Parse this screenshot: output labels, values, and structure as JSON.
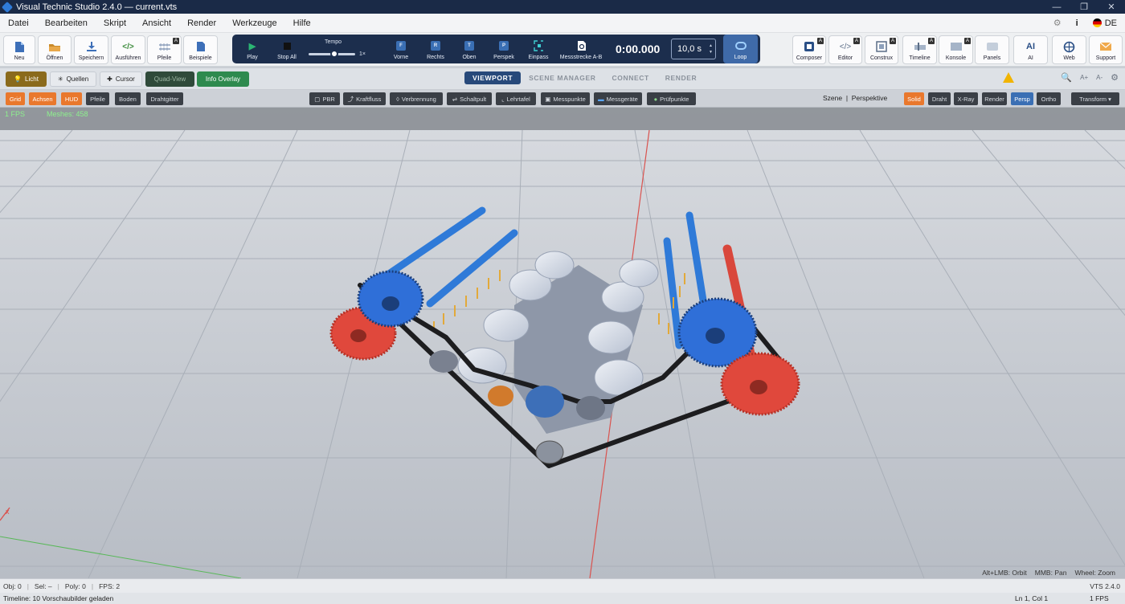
{
  "window": {
    "title": "Visual Technic Studio 2.4.0 — current.vts"
  },
  "menu": {
    "items": [
      "Datei",
      "Bearbeiten",
      "Skript",
      "Ansicht",
      "Render",
      "Werkzeuge",
      "Hilfe"
    ],
    "lang": "DE",
    "info": "i"
  },
  "toolbar": {
    "left": [
      {
        "label": "Neu",
        "icon": "new-file-icon"
      },
      {
        "label": "Öffnen",
        "icon": "folder-icon"
      },
      {
        "label": "Speichern",
        "icon": "save-icon"
      },
      {
        "label": "Ausführen",
        "icon": "run-code-icon"
      },
      {
        "label": "Pfeile",
        "icon": "arrows-icon"
      },
      {
        "label": "Beispiele",
        "icon": "examples-icon"
      }
    ],
    "play": {
      "play": "Play",
      "stop": "Stop All",
      "tempo": "Tempo",
      "tempo_value": "1×",
      "tempo_level": 0.55,
      "views": [
        "Vorne",
        "Rechts",
        "Oben",
        "Perspek",
        "Einpass",
        "Messstrecke A-B"
      ],
      "view_letters": [
        "F",
        "R",
        "T",
        "P"
      ],
      "time": "0:00.000",
      "duration": "10,0 s",
      "loop": "Loop"
    },
    "right": [
      {
        "label": "Composer",
        "icon": "composer-icon"
      },
      {
        "label": "Editor",
        "icon": "code-editor-icon"
      },
      {
        "label": "Construx",
        "icon": "construx-icon"
      },
      {
        "label": "Timeline",
        "icon": "timeline-icon"
      },
      {
        "label": "Konsole",
        "icon": "console-icon"
      },
      {
        "label": "Panels",
        "icon": "panels-icon"
      },
      {
        "label": "AI",
        "icon": "ai-icon"
      },
      {
        "label": "Web",
        "icon": "globe-icon"
      },
      {
        "label": "Support",
        "icon": "mail-icon"
      }
    ]
  },
  "toolbar2": {
    "licht": "Licht",
    "quellen": "Quellen",
    "cursor": "Cursor",
    "quadview": "Quad-View",
    "infooverlay": "Info Overlay",
    "tabs": [
      "VIEWPORT",
      "SCENE MANAGER",
      "CONNECT",
      "RENDER"
    ],
    "font_plus": "A+",
    "font_minus": "A-"
  },
  "toolbar3": {
    "left": [
      "Grid",
      "Achsen",
      "HUD",
      "Pfeile",
      "Boden",
      "Drahtgitter"
    ],
    "center": [
      "PBR",
      "Kraftfluss",
      "Verbrennung",
      "Schaltpult",
      "Lehrtafel",
      "Messpunkte",
      "Messgeräte",
      "Prüfpunkte"
    ],
    "scene": "Szene",
    "perspective": "Perspektive",
    "modes": [
      "Solid",
      "Draht",
      "X-Ray",
      "Render"
    ],
    "proj": [
      "Persp",
      "Ortho"
    ],
    "transform": "Transform ▾"
  },
  "hud": {
    "fps": "1 FPS",
    "meshes": "Meshes: 458"
  },
  "viewport_hints": [
    "Alt+LMB: Orbit",
    "MMB: Pan",
    "Wheel: Zoom"
  ],
  "axis_x": "x",
  "status": {
    "obj": "Obj: 0",
    "sel": "Sel: –",
    "poly": "Poly: 0",
    "fps": "FPS: 2",
    "version": "VTS 2.4.0"
  },
  "bottom": {
    "message": "Timeline: 10 Vorschaubilder geladen",
    "cursor": "Ln 1, Col 1",
    "fps": "1 FPS"
  },
  "colors": {
    "accent_orange": "#e9782d",
    "accent_blue": "#27497a",
    "gear_red": "#e0483c",
    "gear_blue": "#2f6fd8",
    "hud_green": "#8df08d"
  }
}
